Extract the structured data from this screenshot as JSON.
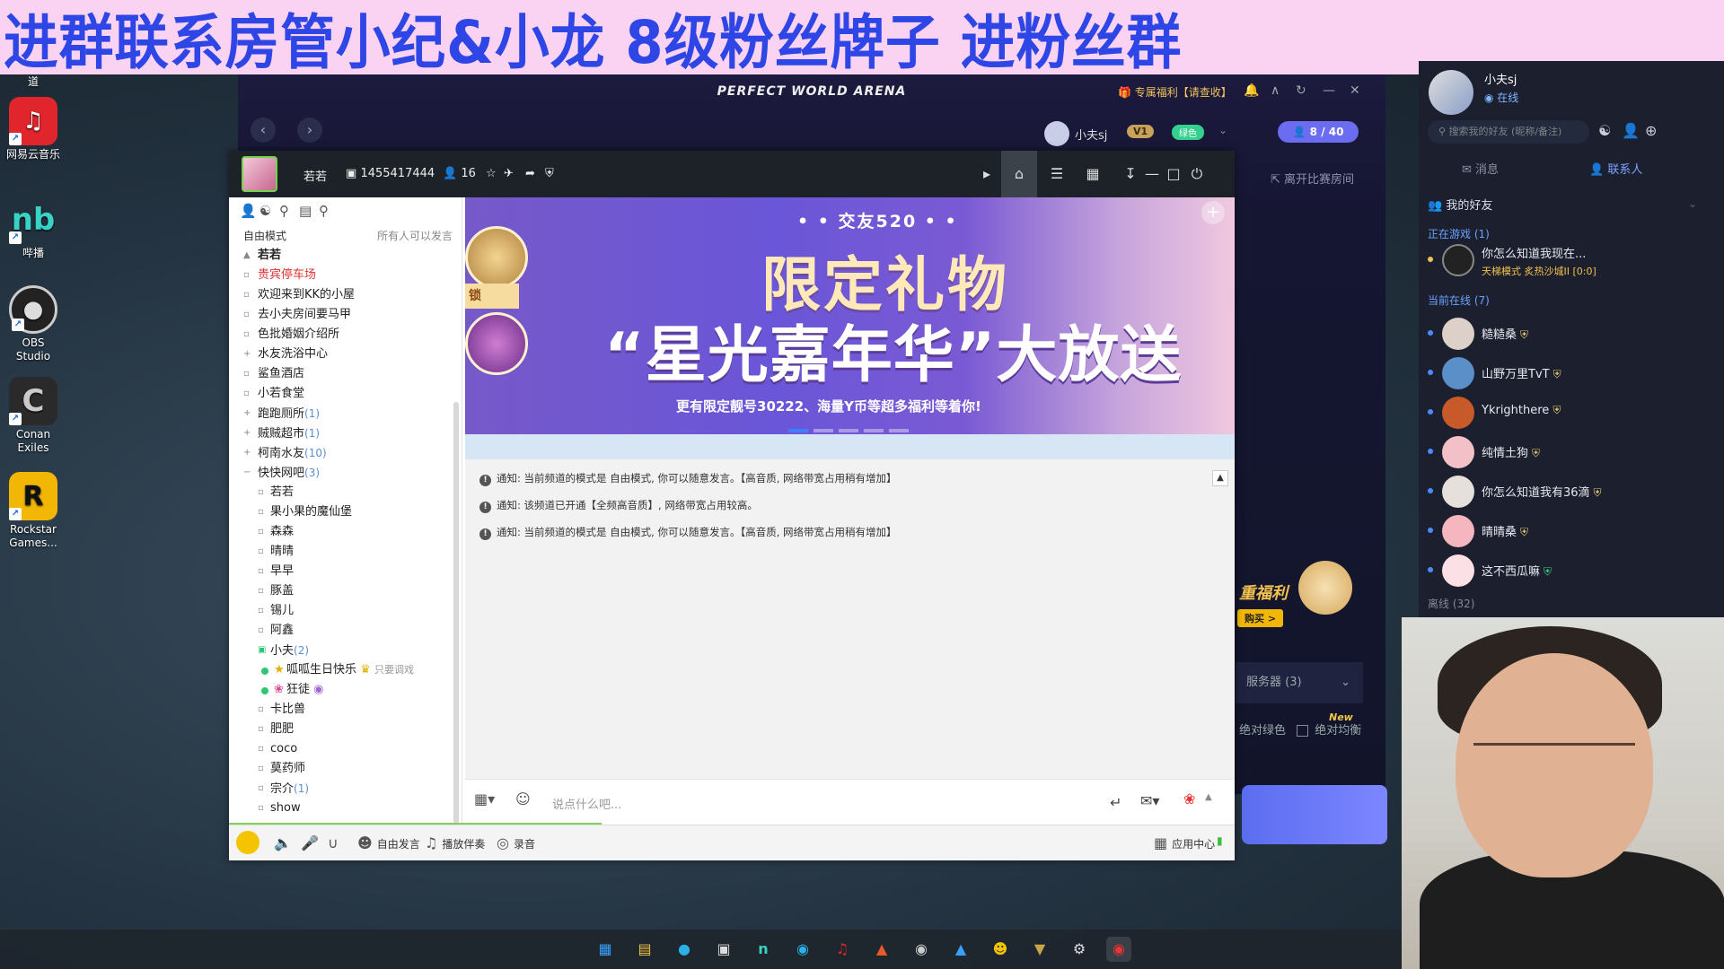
{
  "banner_text": "进群联系房管小纪&小龙  8级粉丝牌子 进粉丝群",
  "desktop": [
    {
      "label": "道"
    },
    {
      "label": "网易云音乐"
    },
    {
      "label": "哔播"
    },
    {
      "label": "OBS Studio"
    },
    {
      "label": "Conan Exiles"
    },
    {
      "label": "Rockstar Games..."
    }
  ],
  "arena": {
    "title": "PERFECT WORLD ARENA",
    "welfare": "专属福利【请查收】",
    "user_nick": "小夫sj",
    "vip_level": "V1",
    "green_badge": "绿色",
    "room_count": "8 / 40",
    "leave_room": "离开比赛房间",
    "server": "服务器 (3)",
    "new_tag": "New",
    "check_green": "绝对绿色",
    "check_balance": "绝对均衡",
    "promo_text": "重福利",
    "promo_btn": "购买 >"
  },
  "yy": {
    "channel_name": "若若",
    "channel_id": "1455417444",
    "online_count": "16",
    "mode_label": "自由模式",
    "mode_right": "所有人可以发言",
    "channels": [
      {
        "name": "若若",
        "type": "root"
      },
      {
        "name": "贵宾停车场",
        "type": "red"
      },
      {
        "name": "欢迎来到KK的小屋",
        "type": "ch"
      },
      {
        "name": "去小夫房间要马甲",
        "type": "ch"
      },
      {
        "name": "色批婚姻介绍所",
        "type": "ch"
      },
      {
        "name": "水友洗浴中心",
        "type": "ch"
      },
      {
        "name": "鲨鱼酒店",
        "type": "ch"
      },
      {
        "name": "小若食堂",
        "type": "ch"
      },
      {
        "name": "跑跑厕所",
        "count": "(1)",
        "type": "ch"
      },
      {
        "name": "贼贼超市",
        "count": "(1)",
        "type": "ch"
      },
      {
        "name": "柯南水友",
        "count": "(10)",
        "type": "ch"
      },
      {
        "name": "快快网吧",
        "count": "(3)",
        "type": "ch"
      },
      {
        "name": "若若",
        "type": "sub"
      },
      {
        "name": "果小果的魔仙堡",
        "type": "sub"
      },
      {
        "name": "森森",
        "type": "sub"
      },
      {
        "name": "晴晴",
        "type": "sub"
      },
      {
        "name": "早早",
        "type": "sub"
      },
      {
        "name": "豚盖",
        "type": "sub"
      },
      {
        "name": "锡儿",
        "type": "sub"
      },
      {
        "name": "阿鑫",
        "type": "sub"
      },
      {
        "name": "小夫",
        "count": "(2)",
        "type": "sub"
      },
      {
        "name": "呱呱生日快乐",
        "type": "member",
        "extra": "只要调戏"
      },
      {
        "name": "狂徒",
        "type": "member"
      },
      {
        "name": "卡比兽",
        "type": "sub"
      },
      {
        "name": "肥肥",
        "type": "sub"
      },
      {
        "name": "coco",
        "type": "sub"
      },
      {
        "name": "莫药师",
        "type": "sub"
      },
      {
        "name": "宗介",
        "count": "(1)",
        "type": "sub"
      },
      {
        "name": "show",
        "type": "sub"
      }
    ],
    "banner": {
      "sub": "• • 交友520 • •",
      "title1": "限定礼物",
      "title2": "“星光嘉年华”大放送",
      "tag": "更有限定靓号30222、海量Y币等超多福利等着你!",
      "lock": "锁"
    },
    "notices": [
      "通知: 当前频道的模式是 自由模式, 你可以随意发言。【高音质, 网络带宽占用稍有增加】",
      "通知: 该频道已开通【全频高音质】, 网络带宽占用较高。",
      "通知: 当前频道的模式是 自由模式, 你可以随意发言。【高音质, 网络带宽占用稍有增加】"
    ],
    "input_placeholder": "说点什么吧...",
    "footer": {
      "free_speak": "自由发言",
      "play_bgm": "播放伴奏",
      "record": "录音",
      "app_center": "应用中心"
    }
  },
  "friends": {
    "user_name": "小夫sj",
    "status": "在线",
    "search_placeholder": "搜索我的好友 (昵称/备注)",
    "tab_messages": "消息",
    "tab_contacts": "联系人",
    "my_friends": "我的好友",
    "in_game_label": "正在游戏",
    "in_game_count": "(1)",
    "in_game": [
      {
        "name": "你怎么知道我现在...",
        "sub": "天梯模式 炙热沙城II [0:0]"
      }
    ],
    "online_label": "当前在线",
    "online_count": "(7)",
    "online": [
      {
        "name": "糙糙桑"
      },
      {
        "name": "山野万里TvT"
      },
      {
        "name": "Ykrighthere"
      },
      {
        "name": "纯情土狗"
      },
      {
        "name": "你怎么知道我有36滴"
      },
      {
        "name": "晴晴桑"
      },
      {
        "name": "这不西瓜嘛"
      }
    ],
    "offline_label": "离线",
    "offline_count": "(32)"
  }
}
